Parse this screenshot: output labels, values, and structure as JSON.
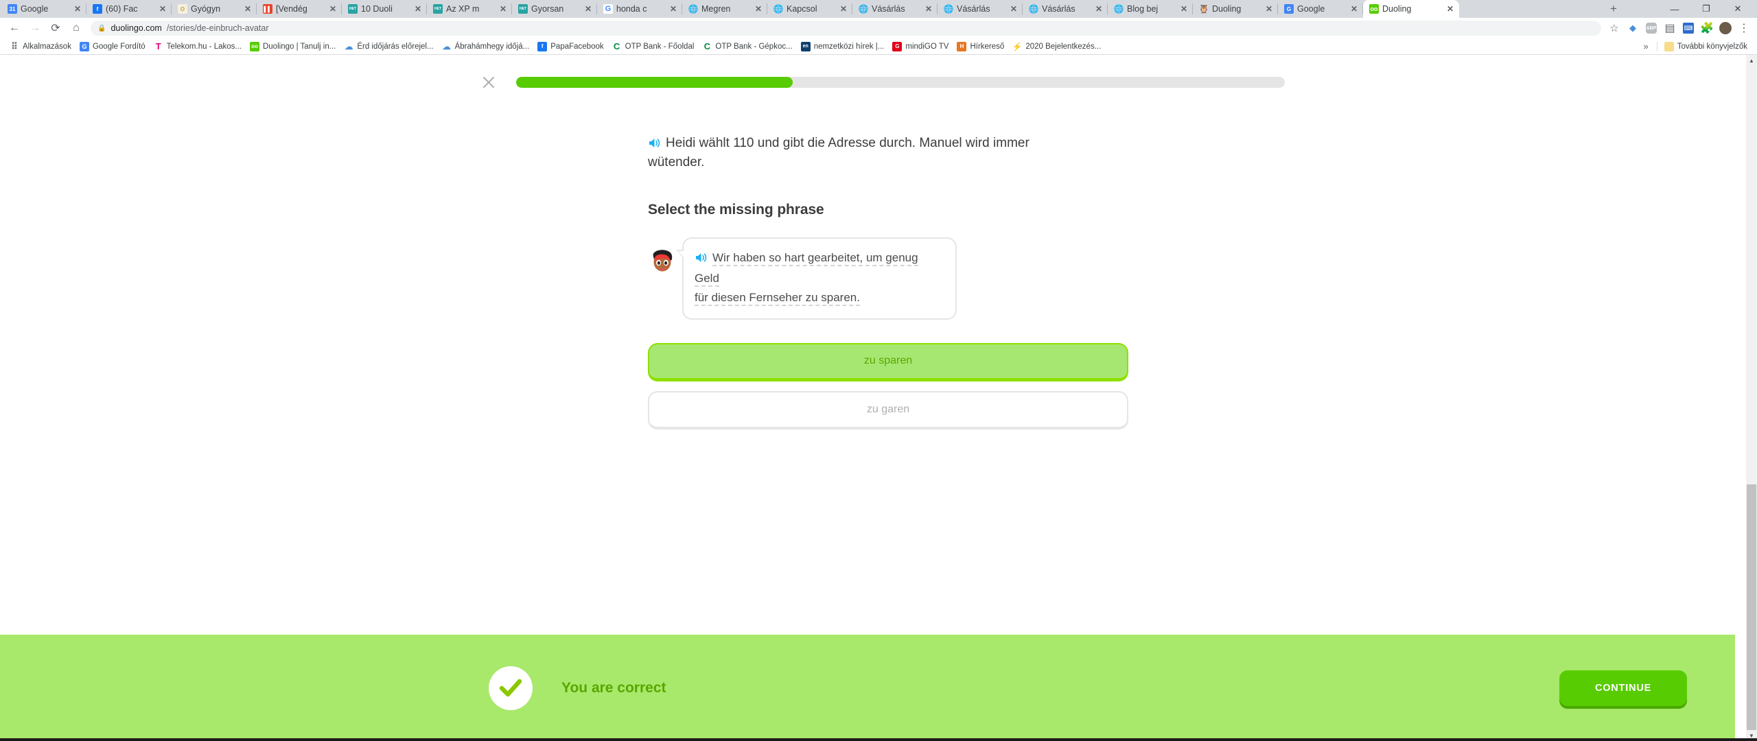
{
  "browser": {
    "tabs": [
      {
        "title": "Google ",
        "icon": "calendar-icon",
        "color": "#4285f4",
        "glyph": "31",
        "active": false
      },
      {
        "title": "(60) Fac",
        "icon": "facebook-icon",
        "color": "#1877f2",
        "glyph": "f",
        "active": false
      },
      {
        "title": "Gyógyn",
        "icon": "ring-icon",
        "color": "#f5f0e1",
        "glyph": "O",
        "active": false
      },
      {
        "title": "[Vendég",
        "icon": "red-icon",
        "color": "#e8422b",
        "glyph": "▌▌",
        "active": false
      },
      {
        "title": "10 Duoli",
        "icon": "happily-ever-travels-icon",
        "color": "#29a3a3",
        "glyph": "HET",
        "active": false
      },
      {
        "title": "Az XP m",
        "icon": "happily-ever-travels-icon",
        "color": "#29a3a3",
        "glyph": "HET",
        "active": false
      },
      {
        "title": "Gyorsan",
        "icon": "happily-ever-travels-icon",
        "color": "#29a3a3",
        "glyph": "HET",
        "active": false
      },
      {
        "title": "honda c",
        "icon": "google-icon",
        "color": "#ffffff",
        "glyph": "G",
        "active": false
      },
      {
        "title": "Megren",
        "icon": "globe-icon",
        "color": "#8a8a8a",
        "glyph": "🌐",
        "active": false
      },
      {
        "title": "Kapcsol",
        "icon": "globe-icon",
        "color": "#8a8a8a",
        "glyph": "🌐",
        "active": false
      },
      {
        "title": "Vásárlás",
        "icon": "globe-icon",
        "color": "#8a8a8a",
        "glyph": "🌐",
        "active": false
      },
      {
        "title": "Vásárlás",
        "icon": "globe-icon",
        "color": "#8a8a8a",
        "glyph": "🌐",
        "active": false
      },
      {
        "title": "Vásárlás",
        "icon": "globe-icon",
        "color": "#8a8a8a",
        "glyph": "🌐",
        "active": false
      },
      {
        "title": "Blog bej",
        "icon": "globe-icon",
        "color": "#8a8a8a",
        "glyph": "🌐",
        "active": false
      },
      {
        "title": "Duoling",
        "icon": "duolingo-owl-icon",
        "color": "#8ee000",
        "glyph": "🦉",
        "active": false
      },
      {
        "title": "Google",
        "icon": "google-translate-icon",
        "color": "#4285f4",
        "glyph": "G",
        "active": false
      },
      {
        "title": "Duoling",
        "icon": "duolingo-icon",
        "color": "#58cc02",
        "glyph": "oo",
        "active": true
      }
    ],
    "new_tab_label": "+",
    "window_controls": {
      "minimize": "—",
      "maximize": "❐",
      "close": "✕"
    },
    "close_tab_label": "✕",
    "nav": {
      "back": "←",
      "forward": "→",
      "reload": "⟳",
      "home": "⌂"
    },
    "omnibox": {
      "lock_icon": "lock-icon",
      "url_domain": "duolingo.com",
      "url_path": "/stories/de-einbruch-avatar"
    },
    "toolbar_icons": [
      {
        "name": "bookmark-star-icon",
        "glyph": "☆"
      },
      {
        "name": "extension-blue-icon",
        "glyph": "◆"
      },
      {
        "name": "adblock-plus-icon",
        "glyph": "ABP"
      },
      {
        "name": "form-filler-icon",
        "glyph": "▤"
      },
      {
        "name": "keyboard-extension-icon",
        "glyph": "⌨"
      },
      {
        "name": "extensions-puzzle-icon",
        "glyph": "🧩"
      },
      {
        "name": "profile-avatar-icon",
        "glyph": "●"
      },
      {
        "name": "chrome-menu-icon",
        "glyph": "⋮"
      }
    ],
    "bookmarks": [
      {
        "label": "Alkalmazások",
        "icon": "apps-grid-icon",
        "color": "#4285f4",
        "glyph": "⠿"
      },
      {
        "label": "Google Fordító",
        "icon": "google-translate-icon",
        "color": "#4285f4",
        "glyph": "G"
      },
      {
        "label": "Telekom.hu - Lakos...",
        "icon": "telekom-icon",
        "color": "#e20074",
        "glyph": "T"
      },
      {
        "label": "Duolingo | Tanulj in...",
        "icon": "duolingo-icon",
        "color": "#58cc02",
        "glyph": "oo"
      },
      {
        "label": "Érd időjárás előrejel...",
        "icon": "weather-icon",
        "color": "#4a90d9",
        "glyph": "☁"
      },
      {
        "label": "Ábrahámhegy időjá...",
        "icon": "weather-icon",
        "color": "#4a90d9",
        "glyph": "☁"
      },
      {
        "label": "PapaFacebook",
        "icon": "facebook-icon",
        "color": "#1877f2",
        "glyph": "f"
      },
      {
        "label": "OTP Bank - Főoldal",
        "icon": "otp-bank-icon",
        "color": "#008a3e",
        "glyph": "C"
      },
      {
        "label": "OTP Bank - Gépkoc...",
        "icon": "otp-bank-icon",
        "color": "#008a3e",
        "glyph": "C"
      },
      {
        "label": "nemzetközi hírek |...",
        "icon": "en-news-icon",
        "color": "#103f6e",
        "glyph": "en"
      },
      {
        "label": "mindiGO TV",
        "icon": "mindigo-icon",
        "color": "#e2001a",
        "glyph": "G"
      },
      {
        "label": "Hírkereső",
        "icon": "hirkereso-icon",
        "color": "#e87722",
        "glyph": "H"
      },
      {
        "label": "2020 Bejelentkezés...",
        "icon": "lightning-icon",
        "color": "#555555",
        "glyph": "⚡"
      }
    ],
    "bookmarks_overflow": "»",
    "other_bookmarks": {
      "label": "További könyvjelzők",
      "icon": "folder-icon"
    }
  },
  "story": {
    "close_label": "✕",
    "progress_percent": 36,
    "narration": "Heidi wählt 110 und gibt die Adresse durch. Manuel wird immer wütender.",
    "prompt_title": "Select the missing phrase",
    "speaker_icon": "speaker-icon",
    "bubble": {
      "avatar": "avatar-manuel",
      "line1": "Wir haben so hart gearbeitet, um genug Geld",
      "line2": "für diesen Fernseher zu sparen."
    },
    "choices": [
      {
        "label": "zu sparen",
        "state": "selected"
      },
      {
        "label": "zu garen",
        "state": "default"
      }
    ],
    "footer": {
      "check_icon": "check-icon",
      "result_text": "You are correct",
      "continue_label": "CONTINUE"
    },
    "colors": {
      "duolingo_green": "#58cc02",
      "light_green": "#a8e86a",
      "correct_text": "#58a700",
      "selected_choice_bg": "#a6e772"
    }
  }
}
